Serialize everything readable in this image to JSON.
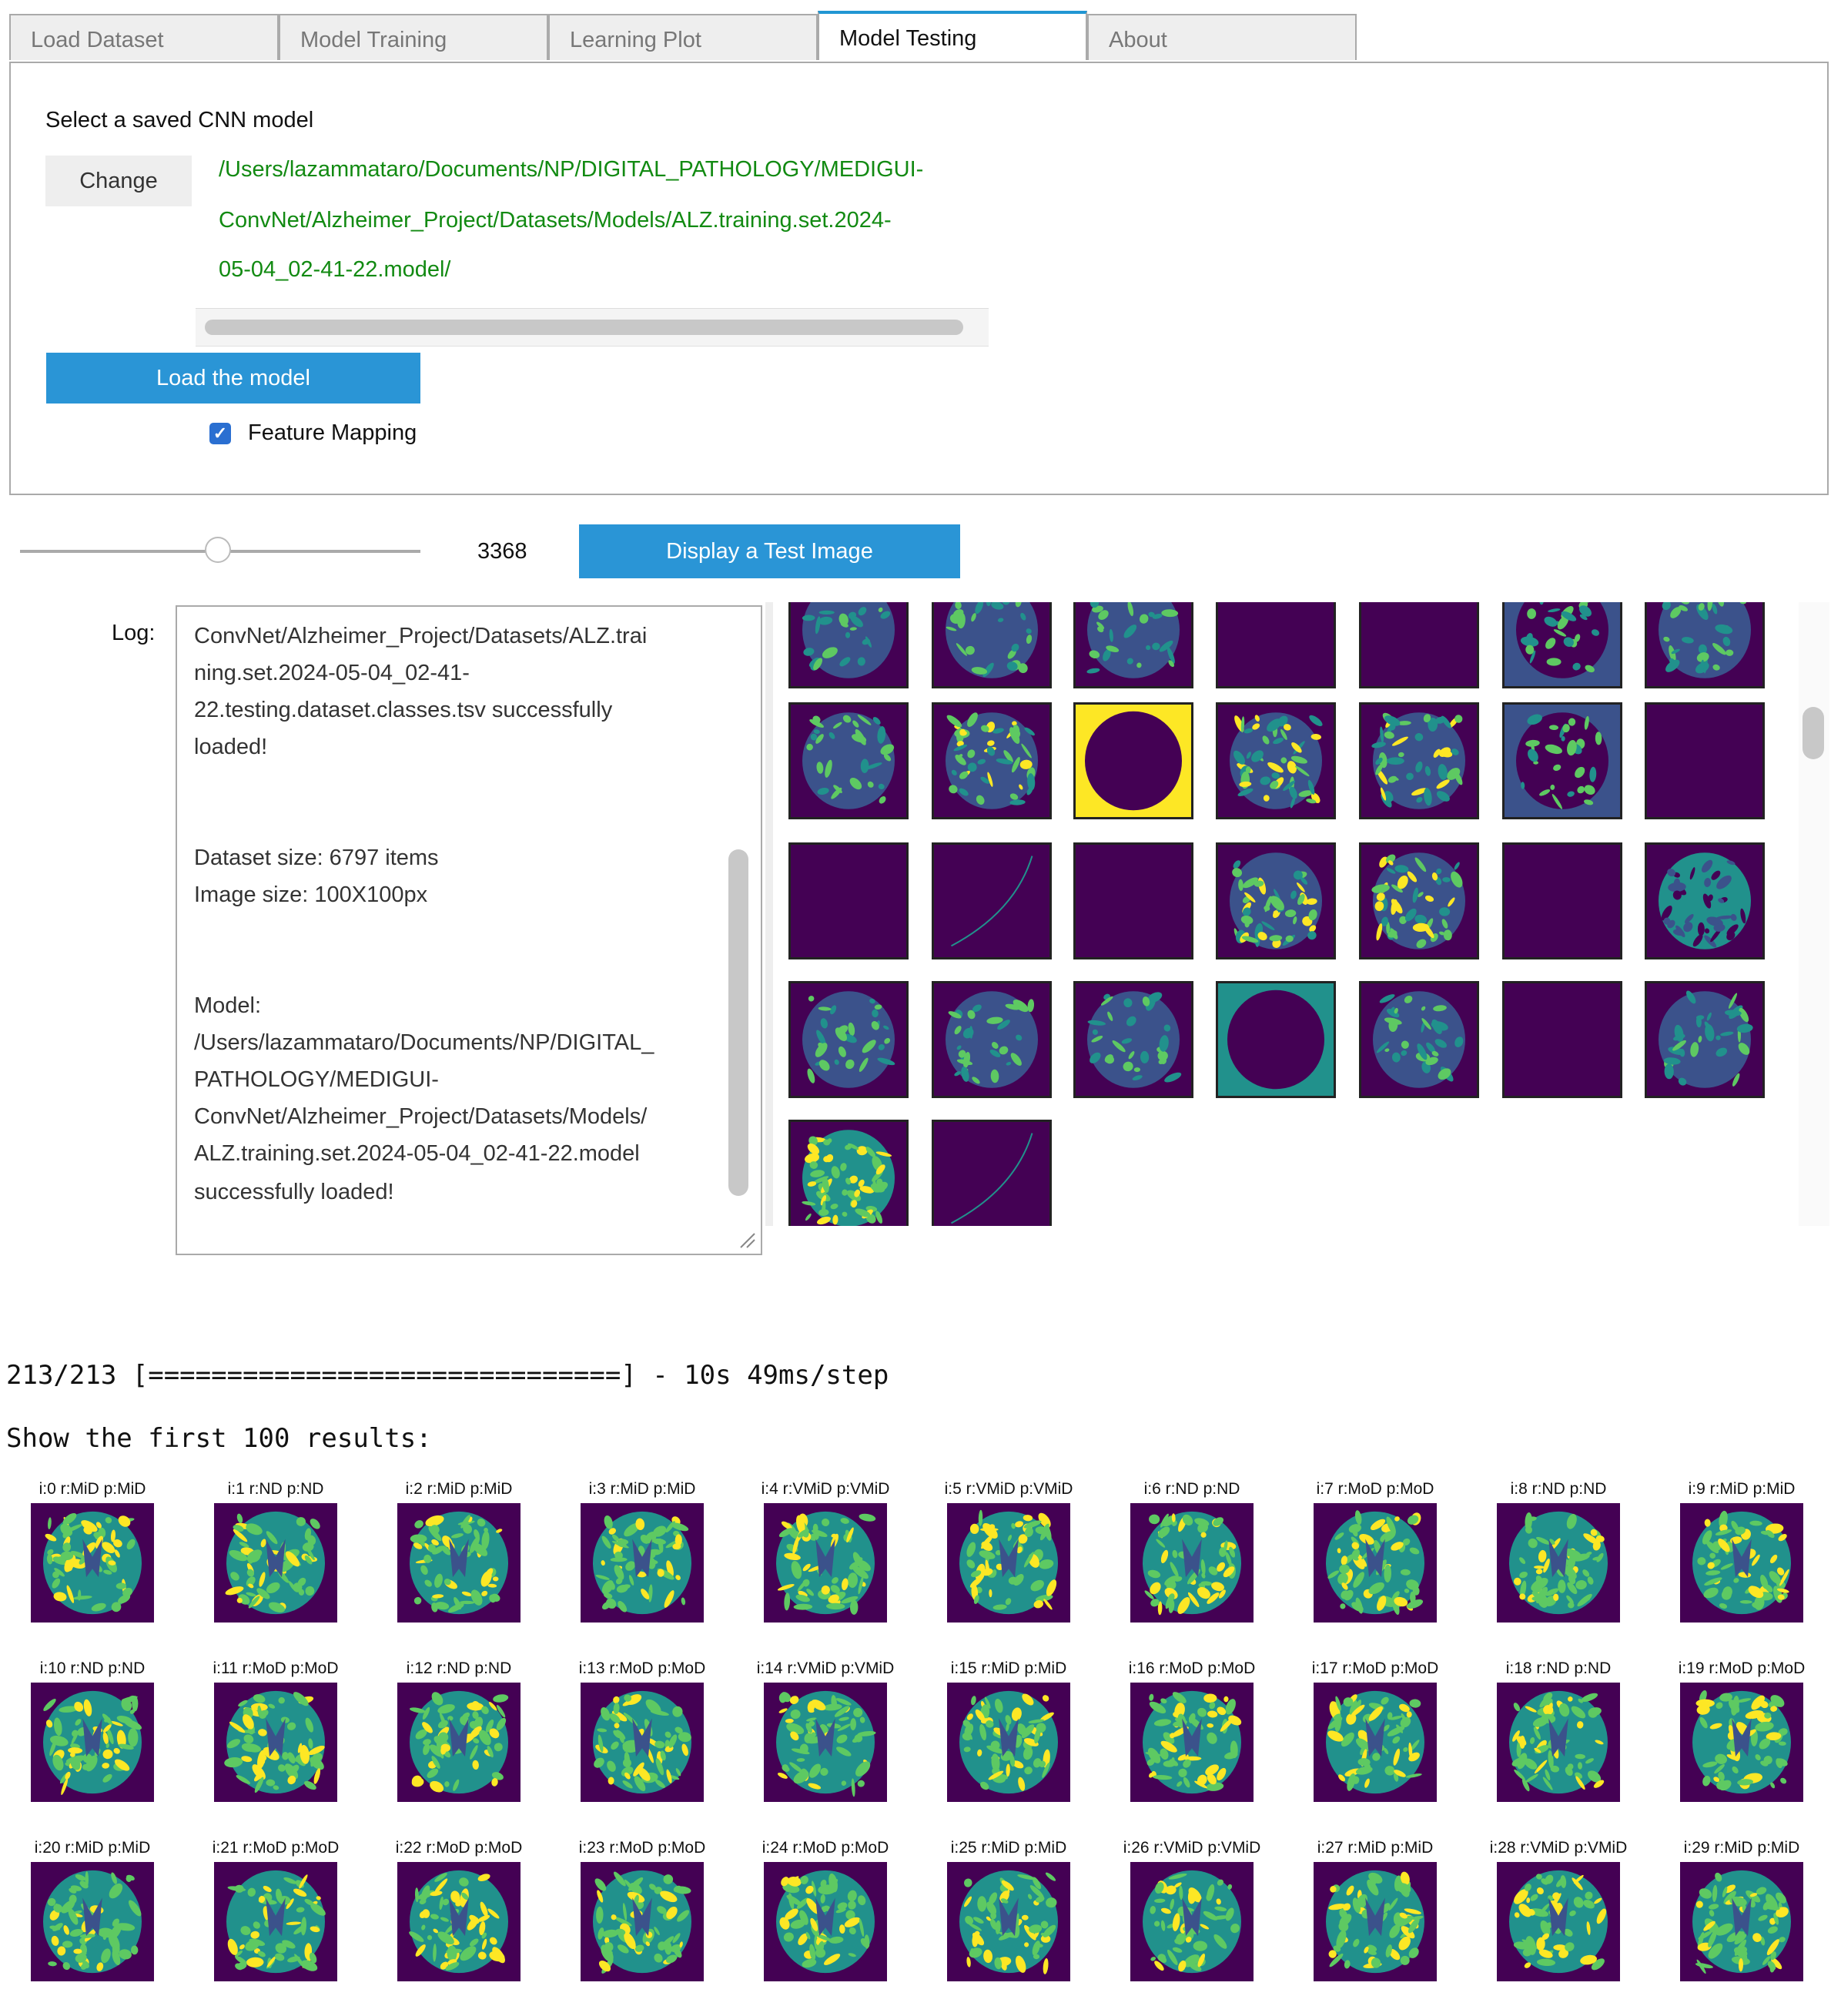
{
  "tabs": [
    {
      "label": "Load Dataset",
      "active": false
    },
    {
      "label": "Model Training",
      "active": false
    },
    {
      "label": "Learning Plot",
      "active": false
    },
    {
      "label": "Model Testing",
      "active": true
    },
    {
      "label": "About",
      "active": false
    }
  ],
  "model_panel": {
    "select_label": "Select a saved CNN model",
    "change_label": "Change",
    "path_lines": [
      "/Users/lazammataro/Documents/NP/DIGITAL_PATHOLOGY/MEDIGUI-",
      "ConvNet/Alzheimer_Project/Datasets/Models/ALZ.training.set.2024-",
      "05-04_02-41-22.model/"
    ],
    "load_label": "Load the model",
    "feature_mapping_label": "Feature Mapping",
    "feature_mapping_checked": true
  },
  "test_controls": {
    "slider_value": "3368",
    "display_label": "Display a Test Image"
  },
  "log": {
    "label": "Log:",
    "lines": [
      "ConvNet/Alzheimer_Project/Datasets/ALZ.trai",
      "ning.set.2024-05-04_02-41-",
      "22.testing.dataset.classes.tsv successfully",
      "loaded!",
      "Dataset size: 6797 items",
      "Image size: 100X100px",
      "Model:",
      "/Users/lazammataro/Documents/NP/DIGITAL_",
      "PATHOLOGY/MEDIGUI-",
      "ConvNet/Alzheimer_Project/Datasets/Models/",
      "ALZ.training.set.2024-05-04_02-41-22.model",
      "successfully loaded!"
    ]
  },
  "output": {
    "progress_line": "213/213 [==============================] - 10s 49ms/step",
    "results_heading": "Show the first 100 results:",
    "results": [
      "i:0 r:MiD p:MiD",
      "i:1 r:ND p:ND",
      "i:2 r:MiD p:MiD",
      "i:3 r:MiD p:MiD",
      "i:4 r:VMiD p:VMiD",
      "i:5 r:VMiD p:VMiD",
      "i:6 r:ND p:ND",
      "i:7 r:MoD p:MoD",
      "i:8 r:ND p:ND",
      "i:9 r:MiD p:MiD",
      "i:10 r:ND p:ND",
      "i:11 r:MoD p:MoD",
      "i:12 r:ND p:ND",
      "i:13 r:MoD p:MoD",
      "i:14 r:VMiD p:VMiD",
      "i:15 r:MiD p:MiD",
      "i:16 r:MoD p:MoD",
      "i:17 r:MoD p:MoD",
      "i:18 r:ND p:ND",
      "i:19 r:MoD p:MoD",
      "i:20 r:MiD p:MiD",
      "i:21 r:MoD p:MoD",
      "i:22 r:MoD p:MoD",
      "i:23 r:MoD p:MoD",
      "i:24 r:MoD p:MoD",
      "i:25 r:MiD p:MiD",
      "i:26 r:VMiD p:VMiD",
      "i:27 r:MiD p:MiD",
      "i:28 r:VMiD p:VMiD",
      "i:29 r:MiD p:MiD"
    ]
  },
  "colors": {
    "accent": "#2a95d6",
    "path_text": "#128a12",
    "viridis_dark": "#440154",
    "viridis_blue": "#3b528b",
    "viridis_teal": "#21918c",
    "viridis_green": "#5ec962",
    "viridis_yellow": "#fde725"
  },
  "feature_maps": [
    "brain-sparse",
    "brain-sparse",
    "brain-sparse",
    "empty",
    "empty",
    "brain-blue",
    "brain-sparse",
    "brain-sparse",
    "brain-dense",
    "yellow-ring",
    "brain-dense",
    "brain-dense",
    "brain-blue",
    "empty",
    "empty",
    "edge-line",
    "empty",
    "brain-dense",
    "brain-dense",
    "empty",
    "brain-teal",
    "brain-sparse",
    "brain-sparse",
    "brain-sparse",
    "teal-ring",
    "brain-sparse",
    "empty",
    "brain-sparse",
    "brain-full",
    "edge-line"
  ]
}
